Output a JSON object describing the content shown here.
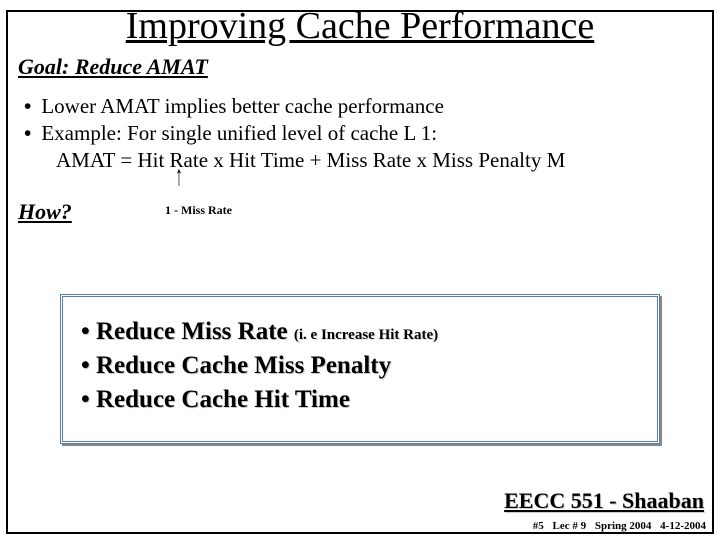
{
  "title": "Improving Cache Performance",
  "goal_label": "Goal:  Reduce AMAT",
  "bullets": {
    "b1": "Lower AMAT implies better cache performance",
    "b2": "Example:  For single unified level of cache L 1:"
  },
  "formula": "AMAT =  Hit Rate x Hit Time +  Miss Rate x Miss Penalty M",
  "how_label": "How?",
  "arrow_glyph": "↑",
  "note": "1 - Miss Rate",
  "box": {
    "i1_main": "• Reduce Miss Rate",
    "i1_sub": "(i. e Increase Hit Rate)",
    "i2": "• Reduce Cache Miss Penalty",
    "i3": "• Reduce Cache Hit Time"
  },
  "footer_course": "EECC 551 - Shaaban",
  "footer_meta": {
    "slide": "#5",
    "lec": "Lec # 9",
    "term": "Spring 2004",
    "date": "4-12-2004"
  }
}
